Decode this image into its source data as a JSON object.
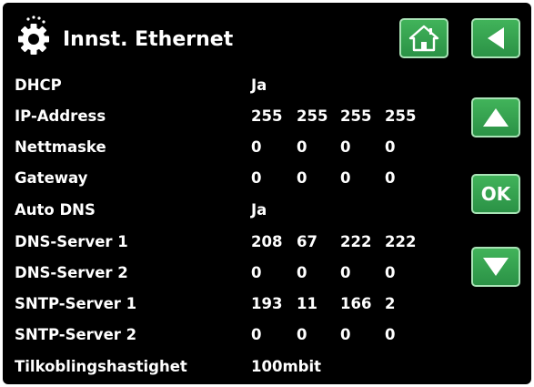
{
  "header": {
    "title": "Innst. Ethernet",
    "icon": "settings-gear-icon"
  },
  "nav": {
    "home_icon": "home-icon",
    "back_icon": "back-arrow-icon",
    "up_icon": "up-arrow-icon",
    "ok_label": "OK",
    "down_icon": "down-arrow-icon"
  },
  "settings": [
    {
      "label": "DHCP",
      "values": [
        "Ja"
      ]
    },
    {
      "label": "IP-Address",
      "values": [
        "255",
        "255",
        "255",
        "255"
      ]
    },
    {
      "label": "Nettmaske",
      "values": [
        "0",
        "0",
        "0",
        "0"
      ]
    },
    {
      "label": "Gateway",
      "values": [
        "0",
        "0",
        "0",
        "0"
      ]
    },
    {
      "label": "Auto DNS",
      "values": [
        "Ja"
      ]
    },
    {
      "label": "DNS-Server 1",
      "values": [
        "208",
        "67",
        "222",
        "222"
      ]
    },
    {
      "label": "DNS-Server 2",
      "values": [
        "0",
        "0",
        "0",
        "0"
      ]
    },
    {
      "label": "SNTP-Server 1",
      "values": [
        "193",
        "11",
        "166",
        "2"
      ]
    },
    {
      "label": "SNTP-Server 2",
      "values": [
        "0",
        "0",
        "0",
        "0"
      ]
    },
    {
      "label": "Tilkoblingshastighet",
      "values": [
        "100mbit"
      ]
    }
  ],
  "colors": {
    "background": "#000000",
    "text": "#ffffff",
    "button": "#2e9a4a",
    "button_border": "#a9e3b6"
  }
}
